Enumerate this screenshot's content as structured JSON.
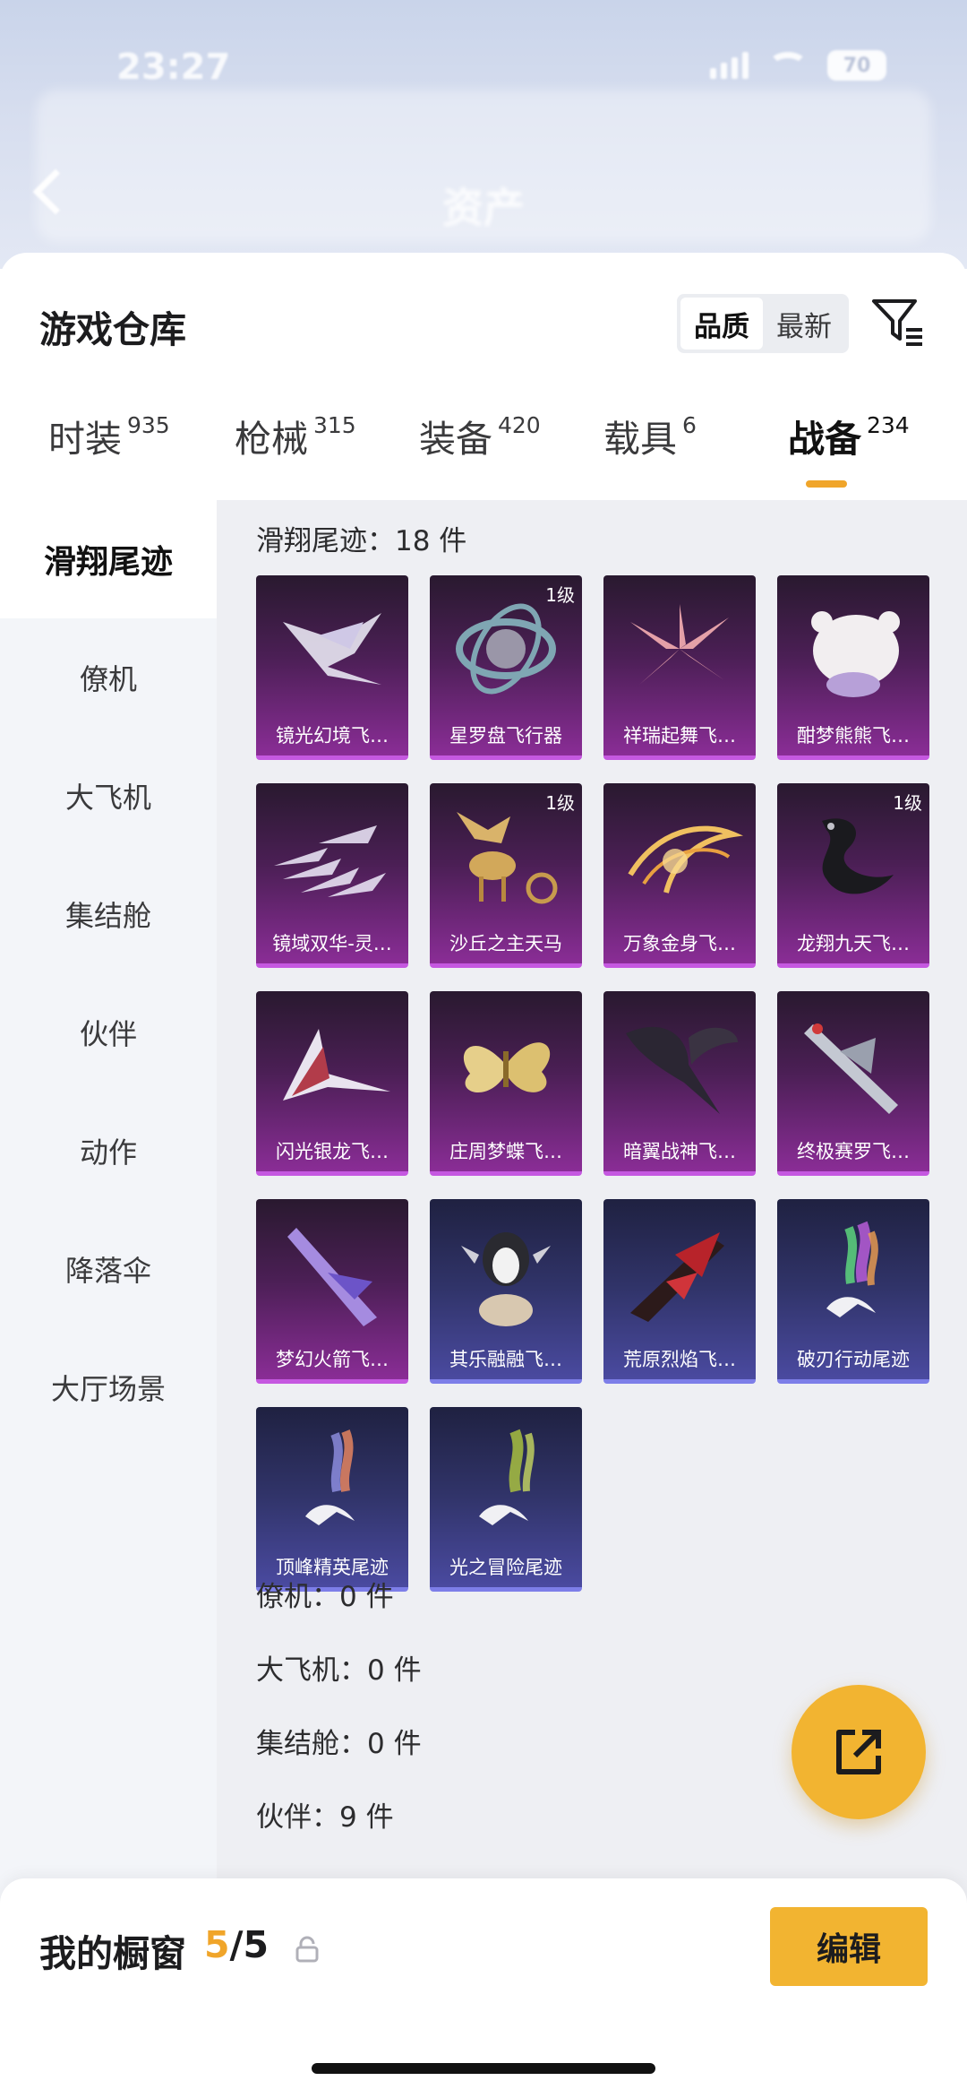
{
  "status_bar": {
    "time": "23:27",
    "battery": "70"
  },
  "header": {
    "title": "资产"
  },
  "card": {
    "title": "游戏仓库",
    "sort_options": [
      "品质",
      "最新"
    ]
  },
  "tabs": [
    {
      "label": "时装",
      "count": "935"
    },
    {
      "label": "枪械",
      "count": "315"
    },
    {
      "label": "装备",
      "count": "420"
    },
    {
      "label": "载具",
      "count": "6"
    },
    {
      "label": "战备",
      "count": "234"
    }
  ],
  "sidebar": {
    "items": [
      "滑翔尾迹",
      "僚机",
      "大飞机",
      "集结舱",
      "伙伴",
      "动作",
      "降落伞",
      "大厅场景"
    ]
  },
  "content": {
    "sections": [
      {
        "label": "滑翔尾迹：18 件"
      },
      {
        "label": "僚机：0 件"
      },
      {
        "label": "大飞机：0 件"
      },
      {
        "label": "集结舱：0 件"
      },
      {
        "label": "伙伴：9 件"
      }
    ],
    "items": [
      {
        "name": "镜光幻境飞…",
        "level": "",
        "icon": "crystal-wings-icon",
        "rarity": "purple"
      },
      {
        "name": "星罗盘飞行器",
        "level": "1级",
        "icon": "astrolabe-icon",
        "rarity": "purple"
      },
      {
        "name": "祥瑞起舞飞…",
        "level": "",
        "icon": "dancing-wings-icon",
        "rarity": "purple"
      },
      {
        "name": "酣梦熊熊飞…",
        "level": "",
        "icon": "sleepy-bear-icon",
        "rarity": "purple"
      },
      {
        "name": "镜域双华-灵…",
        "level": "",
        "icon": "crystal-shards-icon",
        "rarity": "purple"
      },
      {
        "name": "沙丘之主天马",
        "level": "1级",
        "icon": "pegasus-chariot-icon",
        "rarity": "purple"
      },
      {
        "name": "万象金身飞…",
        "level": "",
        "icon": "golden-swirl-icon",
        "rarity": "purple"
      },
      {
        "name": "龙翔九天飞…",
        "level": "1级",
        "icon": "black-dragon-icon",
        "rarity": "purple"
      },
      {
        "name": "闪光银龙飞…",
        "level": "",
        "icon": "silver-dragon-wings-icon",
        "rarity": "purple"
      },
      {
        "name": "庄周梦蝶飞…",
        "level": "",
        "icon": "golden-butterfly-icon",
        "rarity": "purple"
      },
      {
        "name": "暗翼战神飞…",
        "level": "",
        "icon": "dark-wings-icon",
        "rarity": "purple"
      },
      {
        "name": "终极赛罗飞…",
        "level": "",
        "icon": "mech-glider-icon",
        "rarity": "purple"
      },
      {
        "name": "梦幻火箭飞…",
        "level": "",
        "icon": "dream-rocket-icon",
        "rarity": "purple"
      },
      {
        "name": "其乐融融飞…",
        "level": "",
        "icon": "penguin-balloon-icon",
        "rarity": "blue"
      },
      {
        "name": "荒原烈焰飞…",
        "level": "",
        "icon": "flame-glider-icon",
        "rarity": "blue"
      },
      {
        "name": "破刃行动尾迹",
        "level": "",
        "icon": "rainbow-trail-icon",
        "rarity": "blue"
      },
      {
        "name": "顶峰精英尾迹",
        "level": "",
        "icon": "colored-smoke-trail-icon",
        "rarity": "blue"
      },
      {
        "name": "光之冒险尾迹",
        "level": "",
        "icon": "green-smoke-trail-icon",
        "rarity": "blue"
      }
    ]
  },
  "bottom_bar": {
    "label": "我的橱窗",
    "current": "5",
    "total": "/5",
    "edit_label": "编辑"
  },
  "colors": {
    "accent": "#f2b431",
    "purple_rarity": "#8a2d96",
    "blue_rarity": "#4a4aa0"
  }
}
